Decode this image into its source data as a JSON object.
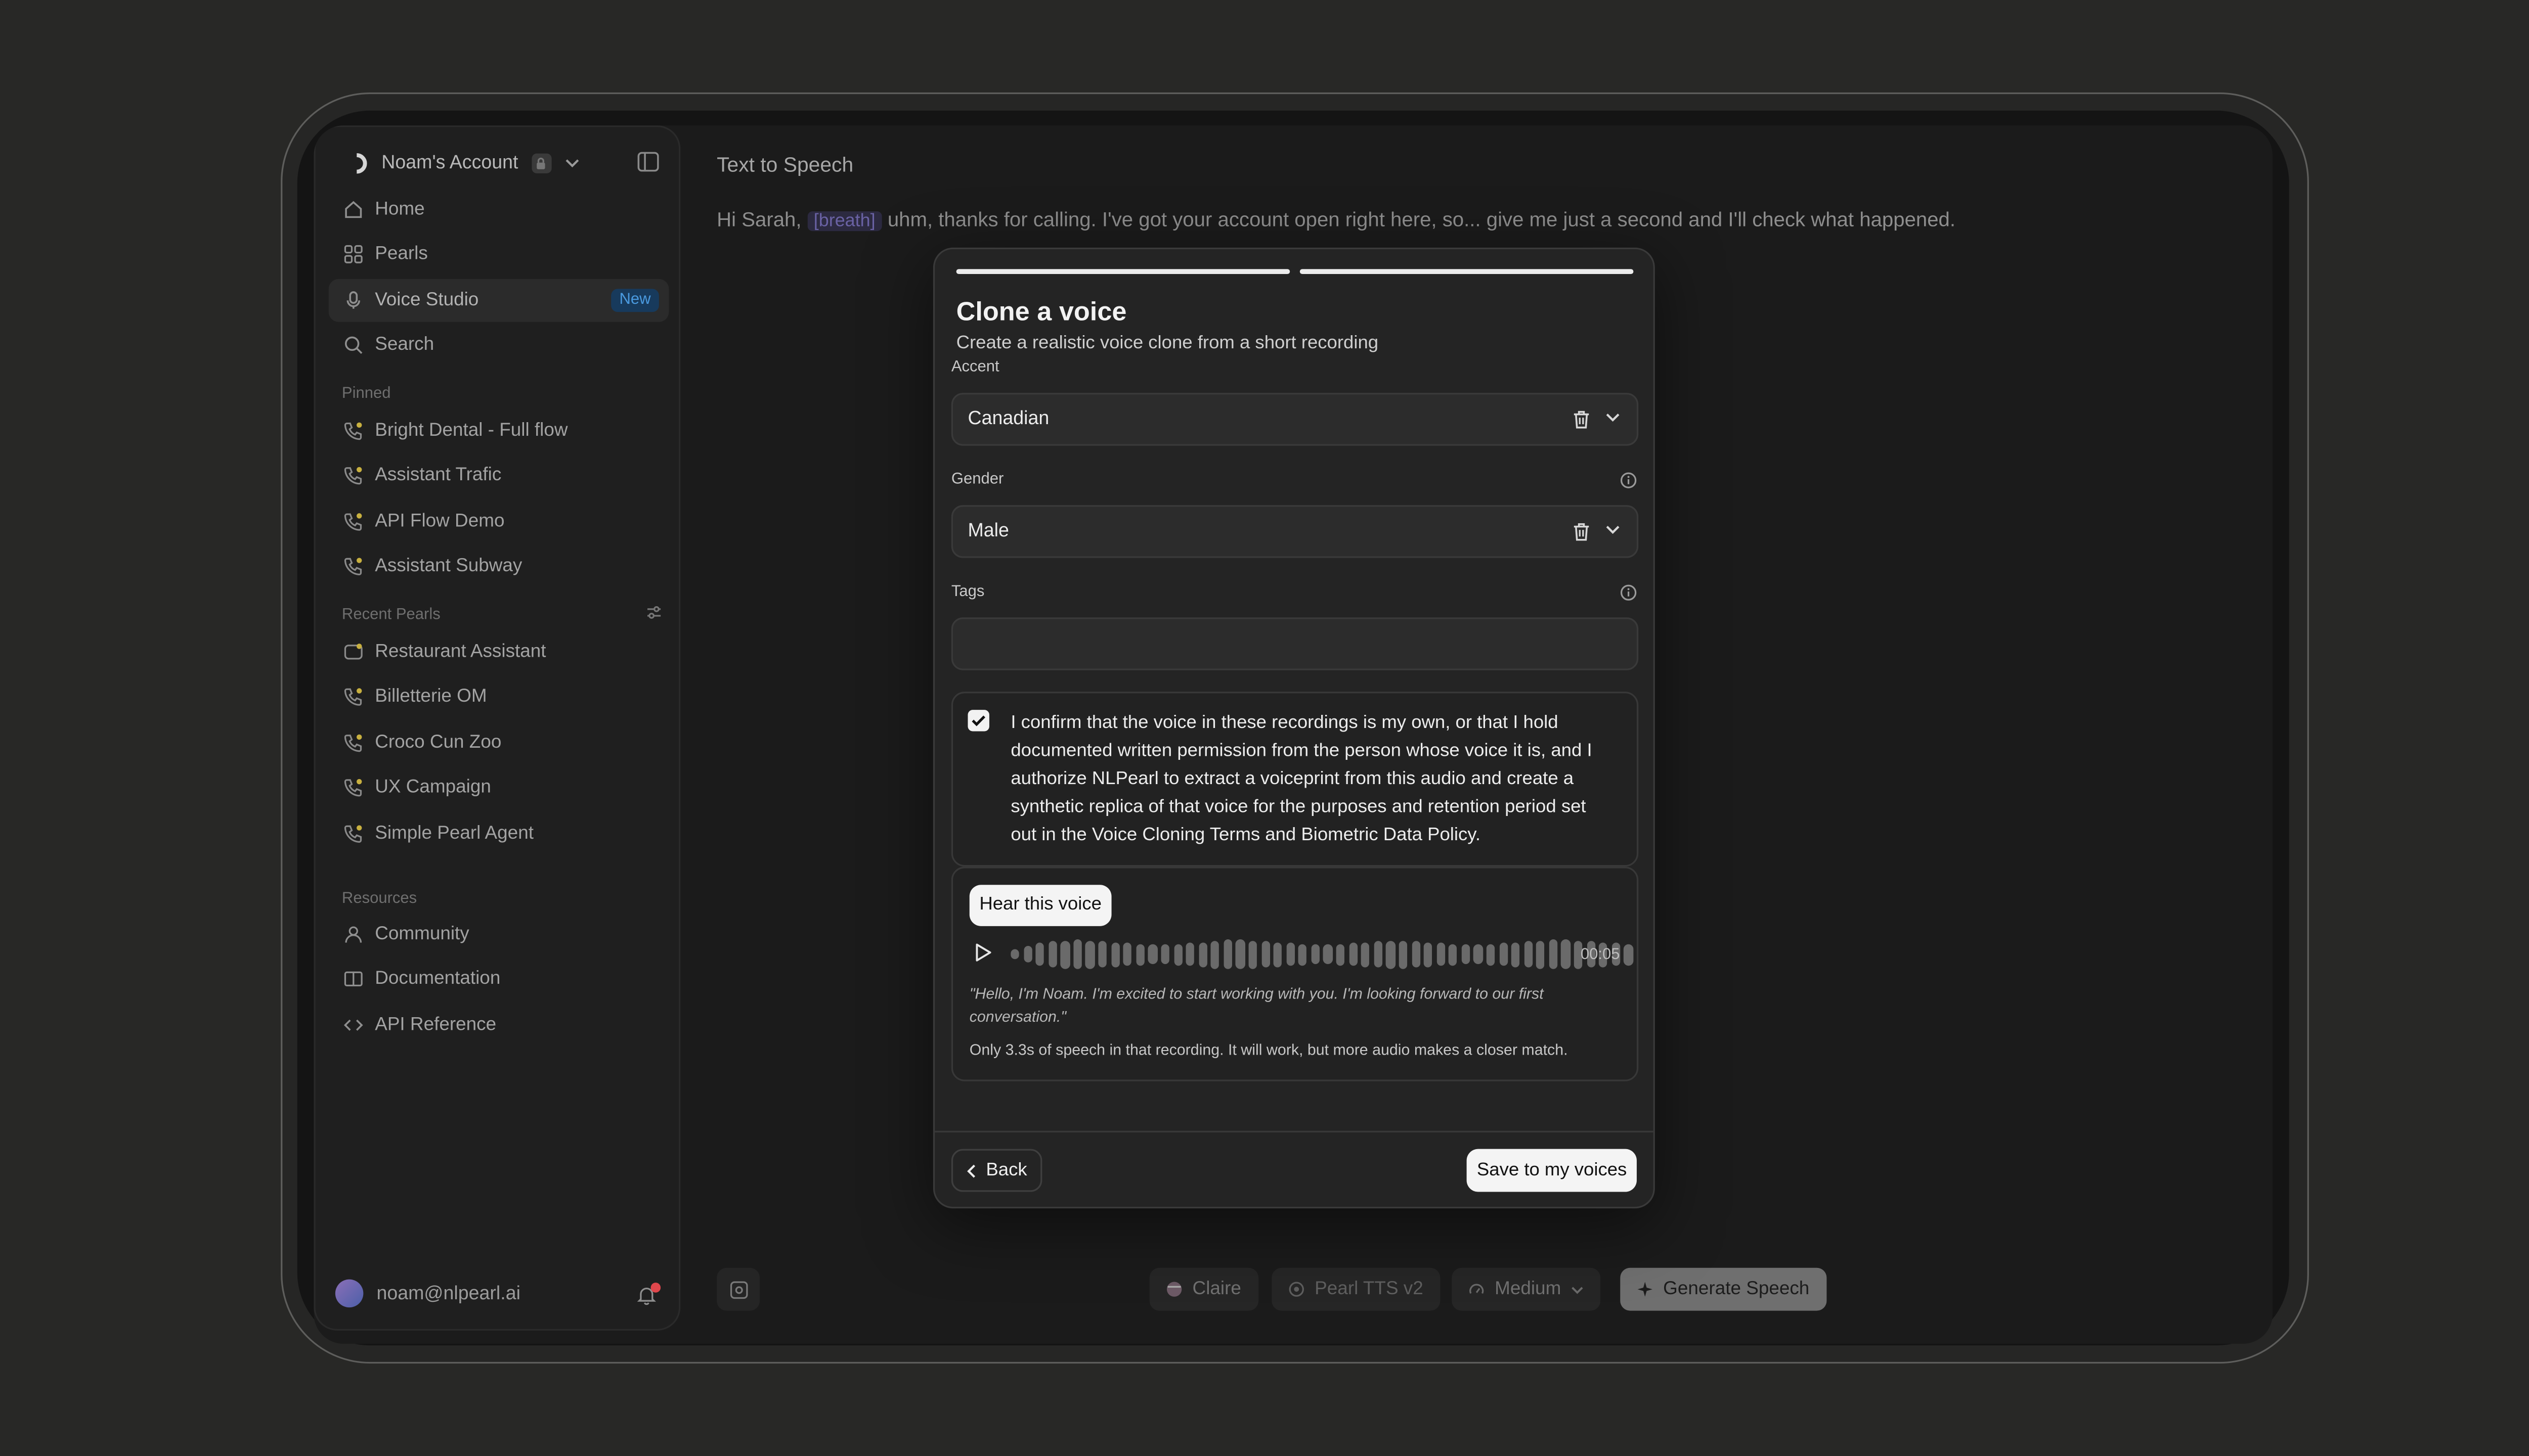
{
  "account": {
    "name": "Noam's Account"
  },
  "nav": [
    {
      "label": "Home",
      "icon": "home-icon"
    },
    {
      "label": "Pearls",
      "icon": "grid-icon"
    },
    {
      "label": "Voice Studio",
      "icon": "microphone-icon",
      "badge": "New"
    },
    {
      "label": "Search",
      "icon": "search-icon"
    }
  ],
  "pinned": {
    "title": "Pinned",
    "items": [
      "Bright Dental - Full flow",
      "Assistant Trafic",
      "API Flow Demo",
      "Assistant Subway"
    ]
  },
  "recent": {
    "title": "Recent Pearls",
    "items": [
      "Restaurant Assistant",
      "Billetterie OM",
      "Croco Cun Zoo",
      "UX Campaign",
      "Simple Pearl Agent"
    ]
  },
  "resources": {
    "title": "Resources",
    "items": [
      "Community",
      "Documentation",
      "API Reference"
    ]
  },
  "user": {
    "email": "noam@nlpearl.ai"
  },
  "main": {
    "title": "Text to Speech",
    "script_before": "Hi Sarah, ",
    "script_tag": "[breath]",
    "script_after": " uhm, thanks for calling. I've got your account open right here, so... give me just a second and I'll check what happened."
  },
  "toolbar": {
    "voice": "Claire",
    "model": "Pearl TTS v2",
    "speed": "Medium",
    "generate": "Generate Speech"
  },
  "modal": {
    "progress_steps": 2,
    "title": "Clone a voice",
    "subtitle": "Create a realistic voice clone from a short recording",
    "accent_label": "Accent",
    "accent_value": "Canadian",
    "gender_label": "Gender",
    "gender_value": "Male",
    "tags_label": "Tags",
    "tags_value": "",
    "consent_checked": true,
    "consent_text": "I confirm that the voice in these recordings is my own, or that I hold documented written permission from the person whose voice it is, and I authorize NLPearl to extract a voiceprint from this audio and create a synthetic replica of that voice for the purposes and retention period set out in the Voice Cloning Terms and Biometric Data Policy.",
    "hear_label": "Hear this voice",
    "duration": "00:05",
    "quote": "\"Hello, I'm Noam. I'm excited to start working with you. I'm looking forward to our first conversation.\"",
    "note": "Only 3.3s of speech in that recording. It will work, but more audio makes a closer match.",
    "back_label": "Back",
    "save_label": "Save to my voices"
  },
  "colors": {
    "accent_badge": "#173a5c",
    "badge_text": "#4a9adf",
    "notification": "#e0474c",
    "tag_bg": "#2c2a40"
  }
}
